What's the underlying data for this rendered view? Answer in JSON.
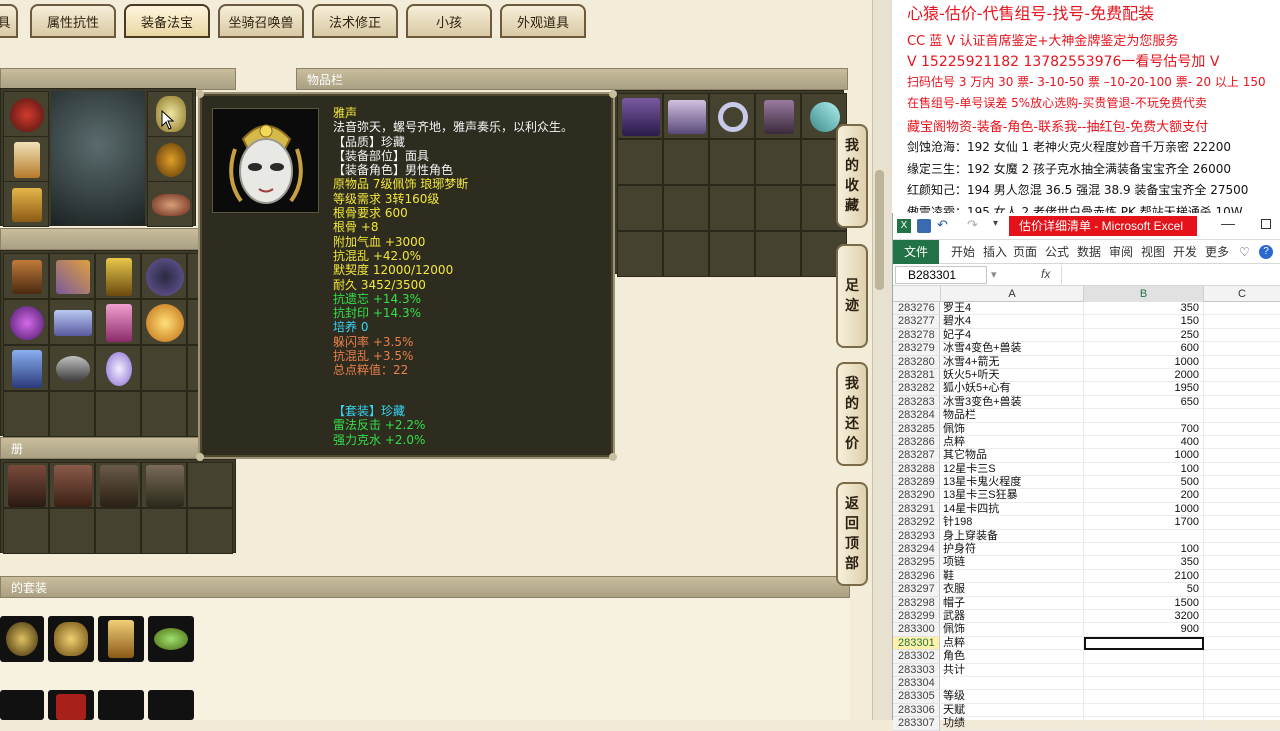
{
  "tabs": [
    {
      "label": "具",
      "active": false
    },
    {
      "label": "属性抗性",
      "active": false
    },
    {
      "label": "装备法宝",
      "active": true
    },
    {
      "label": "坐骑召唤兽",
      "active": false
    },
    {
      "label": "法术修正",
      "active": false
    },
    {
      "label": "小孩",
      "active": false
    },
    {
      "label": "外观道具",
      "active": false
    }
  ],
  "panels": {
    "inventory_title": "物品栏",
    "album_title": "册",
    "suit_title": "的套装"
  },
  "side_buttons": [
    {
      "label": "我的收藏"
    },
    {
      "label": "足迹"
    },
    {
      "label": "我的还价"
    },
    {
      "label": "返回顶部"
    }
  ],
  "tooltip": {
    "lines": [
      {
        "text": "雅声",
        "color": "yellow"
      },
      {
        "text": "法音弥天，螺号齐地，雅声奏乐，以利众生。",
        "color": "white"
      },
      {
        "text": "【品质】珍藏",
        "color": "white"
      },
      {
        "text": "【装备部位】面具",
        "color": "white"
      },
      {
        "text": "【装备角色】男性角色",
        "color": "white"
      },
      {
        "text": "原物品 7级佩饰 琅琊梦断",
        "color": "yellow"
      },
      {
        "text": "等级需求 3转160级",
        "color": "yellow"
      },
      {
        "text": "根骨要求 600",
        "color": "yellow"
      },
      {
        "text": "根骨 +8",
        "color": "yellow"
      },
      {
        "text": "附加气血 +3000",
        "color": "yellow"
      },
      {
        "text": "抗混乱 +42.0%",
        "color": "yellow"
      },
      {
        "text": "默契度 12000/12000",
        "color": "yellow"
      },
      {
        "text": "耐久 3452/3500",
        "color": "yellow"
      },
      {
        "text": "抗遗忘 +14.3%",
        "color": "green"
      },
      {
        "text": "抗封印 +14.3%",
        "color": "green"
      },
      {
        "text": "培养 0",
        "color": "cyan"
      },
      {
        "text": "躲闪率 +3.5%",
        "color": "orange"
      },
      {
        "text": "抗混乱 +3.5%",
        "color": "orange"
      },
      {
        "text": "总点粹值：22",
        "color": "orange"
      }
    ],
    "suit_lines": [
      {
        "text": "【套装】珍藏",
        "color": "cyan"
      },
      {
        "text": "雷法反击 +2.2%",
        "color": "green"
      },
      {
        "text": "强力克水 +2.0%",
        "color": "green"
      }
    ]
  },
  "overlay": {
    "lines": [
      {
        "text": "心猿-估价-代售组号-找号-免费配装",
        "color": "red",
        "size": 16
      },
      {
        "text": "CC 蓝 V 认证首席鉴定+大神金牌鉴定为您服务",
        "color": "red",
        "size": 13
      },
      {
        "text": "V 15225921182     13782553976一看号估号加 V",
        "color": "red",
        "size": 14
      },
      {
        "text": "扫码估号 3 万内 30 票- 3-10-50 票 –10-20-100 票- 20 以上 150",
        "color": "red",
        "size": 12
      },
      {
        "text": "在售组号-单号误差 5%放心选购-买贵管退-不玩免费代卖",
        "color": "red",
        "size": 12
      },
      {
        "text": "藏宝阁物资-装备-角色-联系我--抽红包-免费大额支付",
        "color": "red",
        "size": 13
      },
      {
        "text": "剑蚀沧海：192 女仙 1 老神火克火程度妙音千万亲密 22200",
        "color": "black",
        "size": 12
      },
      {
        "text": "缘定三生：192 女魔 2 孩子克水抽全满装备宝宝齐全 26000",
        "color": "black",
        "size": 12
      },
      {
        "text": "红颜知己：194 男人忽混 36.5 强混 38.9 装备宝宝齐全 27500",
        "color": "black",
        "size": 12
      },
      {
        "text": "傲雪凌霜：195 女人 2 老佬世白骨赤炼 PK 帮站天梯通杀 10W",
        "color": "black",
        "size": 12
      }
    ]
  },
  "excel": {
    "title": "估价详细清单 - Microsoft Excel",
    "ribbon_tabs": [
      "开始",
      "插入",
      "页面",
      "公式",
      "数据",
      "审阅",
      "视图",
      "开发",
      "更多"
    ],
    "file_tab": "文件",
    "namebox": "B283301",
    "fx": "fx",
    "columns": [
      "A",
      "B",
      "C"
    ],
    "rows": [
      {
        "n": "283276",
        "a": "罗王4",
        "b": "350"
      },
      {
        "n": "283277",
        "a": "碧水4",
        "b": "150"
      },
      {
        "n": "283278",
        "a": "妃子4",
        "b": "250"
      },
      {
        "n": "283279",
        "a": "冰雪4变色+兽装",
        "b": "600"
      },
      {
        "n": "283280",
        "a": "冰雪4+箭无",
        "b": "1000"
      },
      {
        "n": "283281",
        "a": "妖火5+听天",
        "b": "2000"
      },
      {
        "n": "283282",
        "a": "狐小妖5+心有",
        "b": "1950"
      },
      {
        "n": "283283",
        "a": "冰雪3变色+兽装",
        "b": "650"
      },
      {
        "n": "283284",
        "a": "物品栏",
        "b": ""
      },
      {
        "n": "283285",
        "a": "佩饰",
        "b": "700"
      },
      {
        "n": "283286",
        "a": "点粹",
        "b": "400"
      },
      {
        "n": "283287",
        "a": "其它物品",
        "b": "1000"
      },
      {
        "n": "283288",
        "a": "12星卡三S",
        "b": "100"
      },
      {
        "n": "283289",
        "a": "13星卡鬼火程度",
        "b": "500"
      },
      {
        "n": "283290",
        "a": "13星卡三S狂暴",
        "b": "200"
      },
      {
        "n": "283291",
        "a": "14星卡四抗",
        "b": "1000"
      },
      {
        "n": "283292",
        "a": "针198",
        "b": "1700"
      },
      {
        "n": "283293",
        "a": "身上穿装备",
        "b": ""
      },
      {
        "n": "283294",
        "a": "护身符",
        "b": "100"
      },
      {
        "n": "283295",
        "a": "项链",
        "b": "350"
      },
      {
        "n": "283296",
        "a": "鞋",
        "b": "2100"
      },
      {
        "n": "283297",
        "a": "衣服",
        "b": "50"
      },
      {
        "n": "283298",
        "a": "帽子",
        "b": "1500"
      },
      {
        "n": "283299",
        "a": "武器",
        "b": "3200"
      },
      {
        "n": "283300",
        "a": "佩饰",
        "b": "900"
      },
      {
        "n": "283301",
        "a": "点粹",
        "b": "",
        "selected": true
      },
      {
        "n": "283302",
        "a": "角色",
        "b": ""
      },
      {
        "n": "283303",
        "a": "共计",
        "b": ""
      },
      {
        "n": "283304",
        "a": "",
        "b": ""
      },
      {
        "n": "283305",
        "a": "等级",
        "b": ""
      },
      {
        "n": "283306",
        "a": "天赋",
        "b": ""
      },
      {
        "n": "283307",
        "a": "功绩",
        "b": ""
      }
    ]
  },
  "colors": {
    "yellow": "#f2e83a",
    "white": "#f4f4f4",
    "green": "#33e04a",
    "cyan": "#33d6f3",
    "orange": "#e8804a",
    "red": "#e8141e",
    "black": "#111111",
    "excel_green": "#217346"
  }
}
